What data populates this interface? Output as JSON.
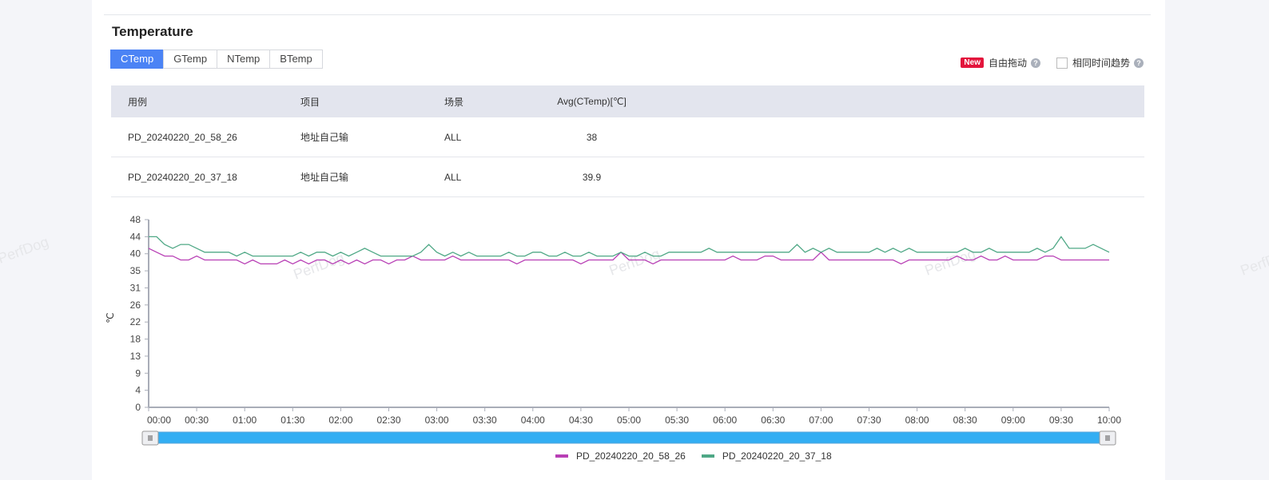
{
  "section_title": "Temperature",
  "tabs": [
    {
      "label": "CTemp",
      "active": true
    },
    {
      "label": "GTemp"
    },
    {
      "label": "NTemp"
    },
    {
      "label": "BTemp"
    }
  ],
  "options": {
    "new_badge": "New",
    "free_drag": "自由拖动",
    "same_time_trend": "相同时间趋势",
    "same_time_checked": false
  },
  "table": {
    "headers": [
      "用例",
      "项目",
      "场景",
      "Avg(CTemp)[℃]"
    ],
    "rows": [
      [
        "PD_20240220_20_58_26",
        "地址自己输",
        "ALL",
        "38"
      ],
      [
        "PD_20240220_20_37_18",
        "地址自己输",
        "ALL",
        "39.9"
      ]
    ]
  },
  "watermark": "PerfDog",
  "chart_data": {
    "type": "line",
    "ylabel": "℃",
    "ylim": [
      0,
      48.4
    ],
    "y_ticks": [
      "0",
      "4",
      "9",
      "13",
      "18",
      "22",
      "26",
      "31",
      "35",
      "40",
      "44",
      "48"
    ],
    "x_ticks": [
      "00:00",
      "00:30",
      "01:00",
      "01:30",
      "02:00",
      "02:30",
      "03:00",
      "03:30",
      "04:00",
      "04:30",
      "05:00",
      "05:30",
      "06:00",
      "06:30",
      "07:00",
      "07:30",
      "08:00",
      "08:30",
      "09:00",
      "09:30",
      "10:00"
    ],
    "x_range_seconds": [
      0,
      600
    ],
    "sample_interval_seconds": 5,
    "legend_position": "bottom",
    "series": [
      {
        "name": "PD_20240220_20_58_26",
        "color": "#b83fb5",
        "values": [
          41,
          40,
          39,
          39,
          38,
          38,
          39,
          38,
          38,
          38,
          38,
          38,
          37,
          38,
          37,
          37,
          37,
          38,
          37,
          38,
          37,
          38,
          38,
          37,
          38,
          37,
          38,
          37,
          38,
          38,
          37,
          38,
          38,
          39,
          38,
          38,
          38,
          38,
          39,
          38,
          38,
          38,
          38,
          38,
          38,
          38,
          37,
          38,
          38,
          38,
          38,
          38,
          38,
          38,
          37,
          38,
          38,
          38,
          38,
          40,
          38,
          38,
          38,
          37,
          38,
          38,
          38,
          38,
          38,
          38,
          38,
          38,
          38,
          39,
          38,
          38,
          38,
          39,
          39,
          38,
          38,
          38,
          38,
          38,
          40,
          38,
          38,
          38,
          38,
          38,
          38,
          38,
          38,
          38,
          37,
          38,
          38,
          38,
          38,
          38,
          38,
          39,
          38,
          38,
          39,
          38,
          38,
          39,
          38,
          38,
          38,
          38,
          39,
          39,
          38,
          38,
          38,
          38,
          38,
          38,
          38
        ]
      },
      {
        "name": "PD_20240220_20_37_18",
        "color": "#4fa886",
        "values": [
          44,
          44,
          42,
          41,
          42,
          42,
          41,
          40,
          40,
          40,
          40,
          39,
          40,
          39,
          39,
          39,
          39,
          39,
          39,
          40,
          39,
          40,
          40,
          39,
          40,
          39,
          40,
          41,
          40,
          39,
          39,
          39,
          39,
          39,
          40,
          42,
          40,
          39,
          40,
          39,
          40,
          39,
          39,
          39,
          39,
          40,
          39,
          39,
          40,
          40,
          39,
          39,
          40,
          39,
          39,
          40,
          39,
          39,
          39,
          40,
          39,
          39,
          40,
          39,
          39,
          40,
          40,
          40,
          40,
          40,
          41,
          40,
          40,
          40,
          40,
          40,
          40,
          40,
          40,
          40,
          40,
          42,
          40,
          41,
          40,
          41,
          40,
          40,
          40,
          40,
          40,
          41,
          40,
          41,
          40,
          41,
          40,
          40,
          40,
          40,
          40,
          40,
          41,
          40,
          40,
          41,
          40,
          40,
          40,
          40,
          40,
          41,
          40,
          41,
          44,
          41,
          41,
          41,
          42,
          41,
          40
        ]
      }
    ]
  },
  "slider": {
    "start_fraction": 0,
    "end_fraction": 1
  }
}
